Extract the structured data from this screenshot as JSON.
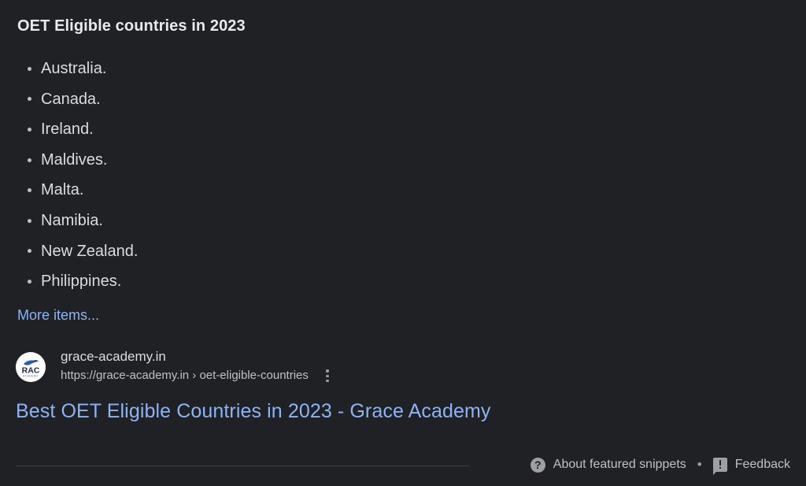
{
  "snippet": {
    "title": "OET Eligible countries in 2023",
    "items": [
      {
        "label": "Australia."
      },
      {
        "label": "Canada."
      },
      {
        "label": "Ireland."
      },
      {
        "label": "Maldives."
      },
      {
        "label": "Malta."
      },
      {
        "label": "Namibia."
      },
      {
        "label": "New Zealand."
      },
      {
        "label": "Philippines."
      }
    ],
    "more_items_label": "More items...",
    "source": {
      "favicon_alt": "RAC Academy logo",
      "favicon_text": "RAC",
      "site_name": "grace-academy.in",
      "url": "https://grace-academy.in › oet-eligible-countries",
      "menu_icon": "kebab-menu-icon"
    },
    "result_title": "Best OET Eligible Countries in 2023 - Grace Academy",
    "footer": {
      "about_icon": "help-circle-icon",
      "about_label": "About featured snippets",
      "separator": "•",
      "feedback_icon": "feedback-icon",
      "feedback_label": "Feedback"
    }
  },
  "colors": {
    "background": "#202124",
    "text_primary": "#e8eaed",
    "text_secondary": "#dadce0",
    "text_muted": "#bdc1c6",
    "link": "#8ab4f8",
    "divider": "#3c4043"
  }
}
